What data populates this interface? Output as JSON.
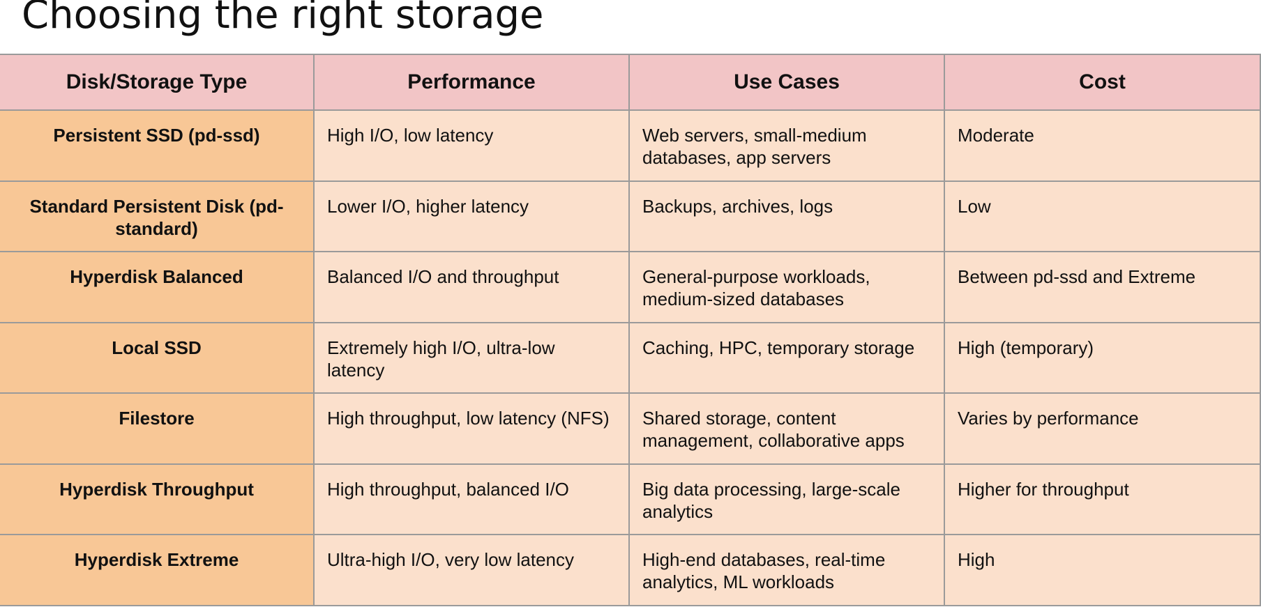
{
  "slide": {
    "title": "Choosing the right storage"
  },
  "table": {
    "headers": {
      "type": "Disk/Storage Type",
      "performance": "Performance",
      "use_cases": "Use Cases",
      "cost": "Cost"
    },
    "rows": [
      {
        "type": "Persistent SSD (pd-ssd)",
        "performance": "High I/O, low latency",
        "use_cases": "Web servers, small-medium databases, app servers",
        "cost": "Moderate"
      },
      {
        "type": "Standard Persistent Disk (pd-standard)",
        "performance": "Lower I/O, higher latency",
        "use_cases": "Backups, archives, logs",
        "cost": "Low"
      },
      {
        "type": "Hyperdisk Balanced",
        "performance": "Balanced I/O and throughput",
        "use_cases": "General-purpose workloads, medium-sized databases",
        "cost": "Between pd-ssd and Extreme"
      },
      {
        "type": "Local SSD",
        "performance": "Extremely high I/O, ultra-low latency",
        "use_cases": "Caching, HPC, temporary storage",
        "cost": "High (temporary)"
      },
      {
        "type": "Filestore",
        "performance": "High throughput, low latency (NFS)",
        "use_cases": "Shared storage, content management, collaborative apps",
        "cost": "Varies by performance"
      },
      {
        "type": "Hyperdisk Throughput",
        "performance": "High throughput, balanced I/O",
        "use_cases": "Big data processing, large-scale analytics",
        "cost": "Higher for throughput"
      },
      {
        "type": "Hyperdisk Extreme",
        "performance": "Ultra-high I/O, very low latency",
        "use_cases": "High-end databases, real-time analytics, ML workloads",
        "cost": "High"
      }
    ]
  },
  "colors": {
    "header_background": "#f2c5c6",
    "type_column_background": "#f8c796",
    "data_cell_background": "#fbe0cc",
    "grid_line": "#9a9a9a"
  }
}
